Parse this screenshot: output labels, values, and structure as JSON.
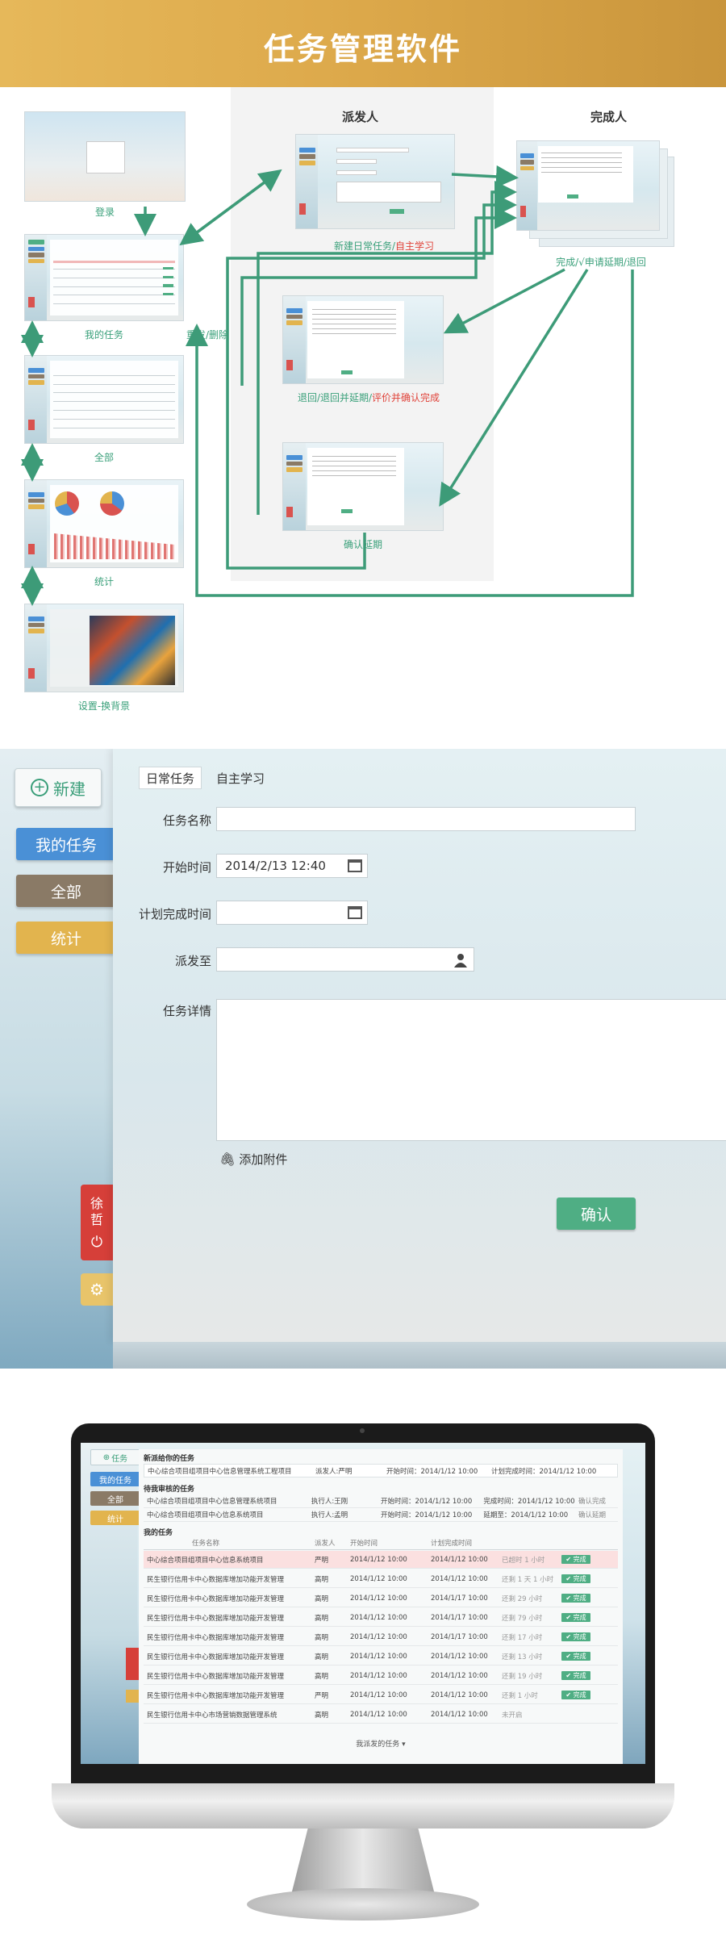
{
  "banner": {
    "title": "任务管理软件"
  },
  "flow": {
    "col_dispatcher": "派发人",
    "col_finisher": "完成人",
    "captions": {
      "login": "登录",
      "my_tasks": "我的任务",
      "all": "全部",
      "stats": "统计",
      "settings": "设置-换背景",
      "new_daily": "新建日常任务/",
      "new_daily_red": "自主学习",
      "finish_apply": "完成/√申请延期/退回",
      "resend_delete": "重发/删除",
      "return": "退回/退回并延期/",
      "return_red": "评价并确认完成",
      "confirm_delay": "确认延期"
    }
  },
  "form": {
    "new_button": "新建",
    "side": {
      "my_tasks": "我的任务",
      "all": "全部",
      "stats": "统计"
    },
    "user": {
      "line1": "徐",
      "line2": "哲",
      "power": "⏻"
    },
    "gear": "⚙",
    "tabs": {
      "daily": "日常任务",
      "study": "自主学习"
    },
    "labels": {
      "name": "任务名称",
      "start": "开始时间",
      "plan_end": "计划完成时间",
      "send_to": "派发至",
      "detail": "任务详情"
    },
    "values": {
      "start": "2014/2/13  12:40"
    },
    "attach": "添加附件",
    "confirm": "确认"
  },
  "monitor": {
    "side": {
      "task": "任务",
      "my_tasks": "我的任务",
      "all": "全部",
      "stats": "统计"
    },
    "section_new": "新派给你的任务",
    "section_approve": "待我审核的任务",
    "section_mine": "我的任务",
    "headers": [
      "任务名称",
      "派发人",
      "开始时间",
      "计划完成时间"
    ],
    "new_task": {
      "name": "中心综合项目组项目中心信息管理系统工程项目",
      "by": "派发人:严明",
      "start": "开始时间：2014/1/12 10:00",
      "end": "计划完成时间：2014/1/12 10:00"
    },
    "approve_rows": [
      {
        "name": "中心综合项目组项目中心信息管理系统项目",
        "by": "执行人:王刚",
        "start": "开始时间：2014/1/12 10:00",
        "end": "完成时间：2014/1/12 10:00",
        "action": "确认完成"
      },
      {
        "name": "中心综合项目组项目中心信息系统项目",
        "by": "执行人:孟明",
        "start": "开始时间：2014/1/12 10:00",
        "end": "延期至：2014/1/12 10:00",
        "action": "确认延期"
      }
    ],
    "rows": [
      {
        "name": "中心综合项目组项目中心信息系统项目",
        "by": "严明",
        "start": "2014/1/12 10:00",
        "end": "2014/1/12 10:00",
        "status": "已超时 1 小时",
        "btn": "完成"
      },
      {
        "name": "民生银行信用卡中心数据库增加功能开发管理",
        "by": "高明",
        "start": "2014/1/12 10:00",
        "end": "2014/1/12 10:00",
        "status": "还剩 1 天 1 小时",
        "btn": "完成"
      },
      {
        "name": "民生银行信用卡中心数据库增加功能开发管理",
        "by": "高明",
        "start": "2014/1/12 10:00",
        "end": "2014/1/17 10:00",
        "status": "还剩 29 小时",
        "btn": "完成"
      },
      {
        "name": "民生银行信用卡中心数据库增加功能开发管理",
        "by": "高明",
        "start": "2014/1/12 10:00",
        "end": "2014/1/17 10:00",
        "status": "还剩 79 小时",
        "btn": "完成"
      },
      {
        "name": "民生银行信用卡中心数据库增加功能开发管理",
        "by": "高明",
        "start": "2014/1/12 10:00",
        "end": "2014/1/17 10:00",
        "status": "还剩 17 小时",
        "btn": "完成"
      },
      {
        "name": "民生银行信用卡中心数据库增加功能开发管理",
        "by": "高明",
        "start": "2014/1/12 10:00",
        "end": "2014/1/12 10:00",
        "status": "还剩 13 小时",
        "btn": "完成"
      },
      {
        "name": "民生银行信用卡中心数据库增加功能开发管理",
        "by": "高明",
        "start": "2014/1/12 10:00",
        "end": "2014/1/12 10:00",
        "status": "还剩 19 小时",
        "btn": "完成"
      },
      {
        "name": "民生银行信用卡中心数据库增加功能开发管理",
        "by": "严明",
        "start": "2014/1/12 10:00",
        "end": "2014/1/12 10:00",
        "status": "还剩 1 小时",
        "btn": "完成"
      },
      {
        "name": "民生银行信用卡中心市场营销数据管理系统",
        "by": "高明",
        "start": "2014/1/12 10:00",
        "end": "2014/1/12 10:00",
        "status": "未开启",
        "btn": ""
      }
    ],
    "more": "我派发的任务 ▾"
  },
  "colors": {
    "accent": "#4fae84",
    "blue": "#4a90d6",
    "brown": "#8a7a66",
    "gold": "#e2b44e",
    "red": "#d63f39"
  }
}
